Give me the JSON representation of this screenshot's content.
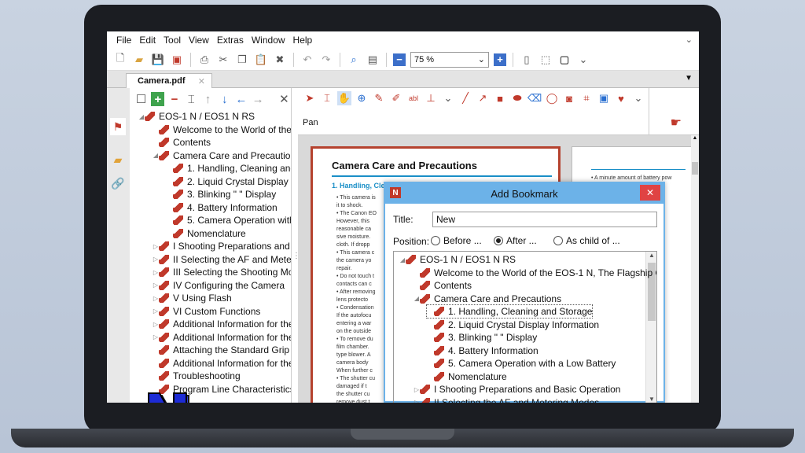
{
  "menu": [
    "File",
    "Edit",
    "Tool",
    "View",
    "Extras",
    "Window",
    "Help"
  ],
  "toolbar": {
    "zoom_value": "75 %"
  },
  "tab": {
    "label": "Camera.pdf"
  },
  "annot": {
    "pan_label": "Pan"
  },
  "bookmarks": [
    {
      "label": "EOS-1 N / EOS1 N RS",
      "level": 0,
      "exp": "◢"
    },
    {
      "label": "Welcome to the World of the",
      "level": 1,
      "exp": ""
    },
    {
      "label": "Contents",
      "level": 1,
      "exp": ""
    },
    {
      "label": "Camera Care and Precautions",
      "level": 1,
      "exp": "◢"
    },
    {
      "label": "1. Handling, Cleaning and",
      "level": 2,
      "exp": ""
    },
    {
      "label": "2. Liquid Crystal Display Ir",
      "level": 2,
      "exp": ""
    },
    {
      "label": "3. Blinking \" \" Display",
      "level": 2,
      "exp": ""
    },
    {
      "label": "4. Battery Information",
      "level": 2,
      "exp": ""
    },
    {
      "label": "5. Camera Operation with",
      "level": 2,
      "exp": ""
    },
    {
      "label": "Nomenclature",
      "level": 2,
      "exp": ""
    },
    {
      "label": "I Shooting Preparations and B",
      "level": 1,
      "exp": "▷"
    },
    {
      "label": "II Selecting the AF and Meteri",
      "level": 1,
      "exp": "▷"
    },
    {
      "label": "III Selecting the Shooting Moc",
      "level": 1,
      "exp": "▷"
    },
    {
      "label": "IV Configuring the Camera",
      "level": 1,
      "exp": "▷"
    },
    {
      "label": "V Using Flash",
      "level": 1,
      "exp": "▷"
    },
    {
      "label": "VI Custom Functions",
      "level": 1,
      "exp": "▷"
    },
    {
      "label": "Additional Information for the",
      "level": 1,
      "exp": "▷"
    },
    {
      "label": "Additional Information for the",
      "level": 1,
      "exp": "▷"
    },
    {
      "label": "Attaching the Standard Grip",
      "level": 1,
      "exp": ""
    },
    {
      "label": "Additional Information for the",
      "level": 1,
      "exp": ""
    },
    {
      "label": "Troubleshooting",
      "level": 1,
      "exp": ""
    },
    {
      "label": "Program Line Characteristics",
      "level": 1,
      "exp": ""
    }
  ],
  "document": {
    "heading": "Camera Care and Precautions",
    "subheading": "1. Handling, Cleaning and Storage",
    "lines": [
      "• This camera is",
      "  it to shock.",
      "• The Canon EO",
      "  However, this",
      "  reasonable ca",
      "  sive moisture.",
      "  cloth. If dropp",
      "• This camera c",
      "  the camera yo",
      "  repair.",
      "• Do not touch t",
      "  contacts can c",
      "• After removing",
      "  lens protecto",
      "• Condensation",
      "  If the autofocu",
      "  entering a war",
      "  on the outside",
      "• To remove du",
      "  film chamber.",
      "  type blower. A",
      "  camera body",
      "  When further c",
      "• The shutter cu",
      "  damaged if t",
      "  the shutter cu",
      "  remove dust t",
      "  and be carefu",
      "  air onto the c",
      "  are not remov"
    ],
    "page2_lines": [
      "• A minute amount of battery pow",
      "  the battery's re",
      "  ely",
      "  a's c",
      "  a to",
      "  d th",
      "  an b",
      "",
      "  nfor",
      "  e bl",
      "  al d",
      "  relat",
      "  s ra",
      "  urre",
      "  is re",
      "  ure",
      "  kbla",
      "  ntinu",
      "  he",
      "  e he",
      "  ent",
      "  cient",
      "  the"
    ]
  },
  "dialog": {
    "title": "Add Bookmark",
    "title_label": "Title:",
    "title_value": "New",
    "position_label": "Position:",
    "options": [
      "Before ...",
      "After ...",
      "As child of ..."
    ],
    "selected_option": "After ...",
    "tree": [
      {
        "label": "EOS-1 N / EOS1 N RS",
        "level": 0,
        "exp": "◢"
      },
      {
        "label": "Welcome to the World of the EOS-1 N, The Flagship Ca",
        "level": 1,
        "exp": ""
      },
      {
        "label": "Contents",
        "level": 1,
        "exp": ""
      },
      {
        "label": "Camera Care and Precautions",
        "level": 1,
        "exp": "◢"
      },
      {
        "label": "1. Handling, Cleaning and Storage",
        "level": 2,
        "exp": ""
      },
      {
        "label": "2. Liquid Crystal Display Information",
        "level": 2,
        "exp": ""
      },
      {
        "label": "3. Blinking \" \" Display",
        "level": 2,
        "exp": ""
      },
      {
        "label": "4. Battery Information",
        "level": 2,
        "exp": ""
      },
      {
        "label": "5. Camera Operation with a Low Battery",
        "level": 2,
        "exp": ""
      },
      {
        "label": "Nomenclature",
        "level": 2,
        "exp": ""
      },
      {
        "label": "I Shooting Preparations and Basic Operation",
        "level": 1,
        "exp": "▷"
      },
      {
        "label": "II Selecting the AF and Metering Modes",
        "level": 1,
        "exp": "▷"
      }
    ],
    "selected_index": 4
  },
  "colors": {
    "accent": "#c0392b",
    "dialog_title": "#6cb2e8",
    "link": "#1a8fc7"
  }
}
